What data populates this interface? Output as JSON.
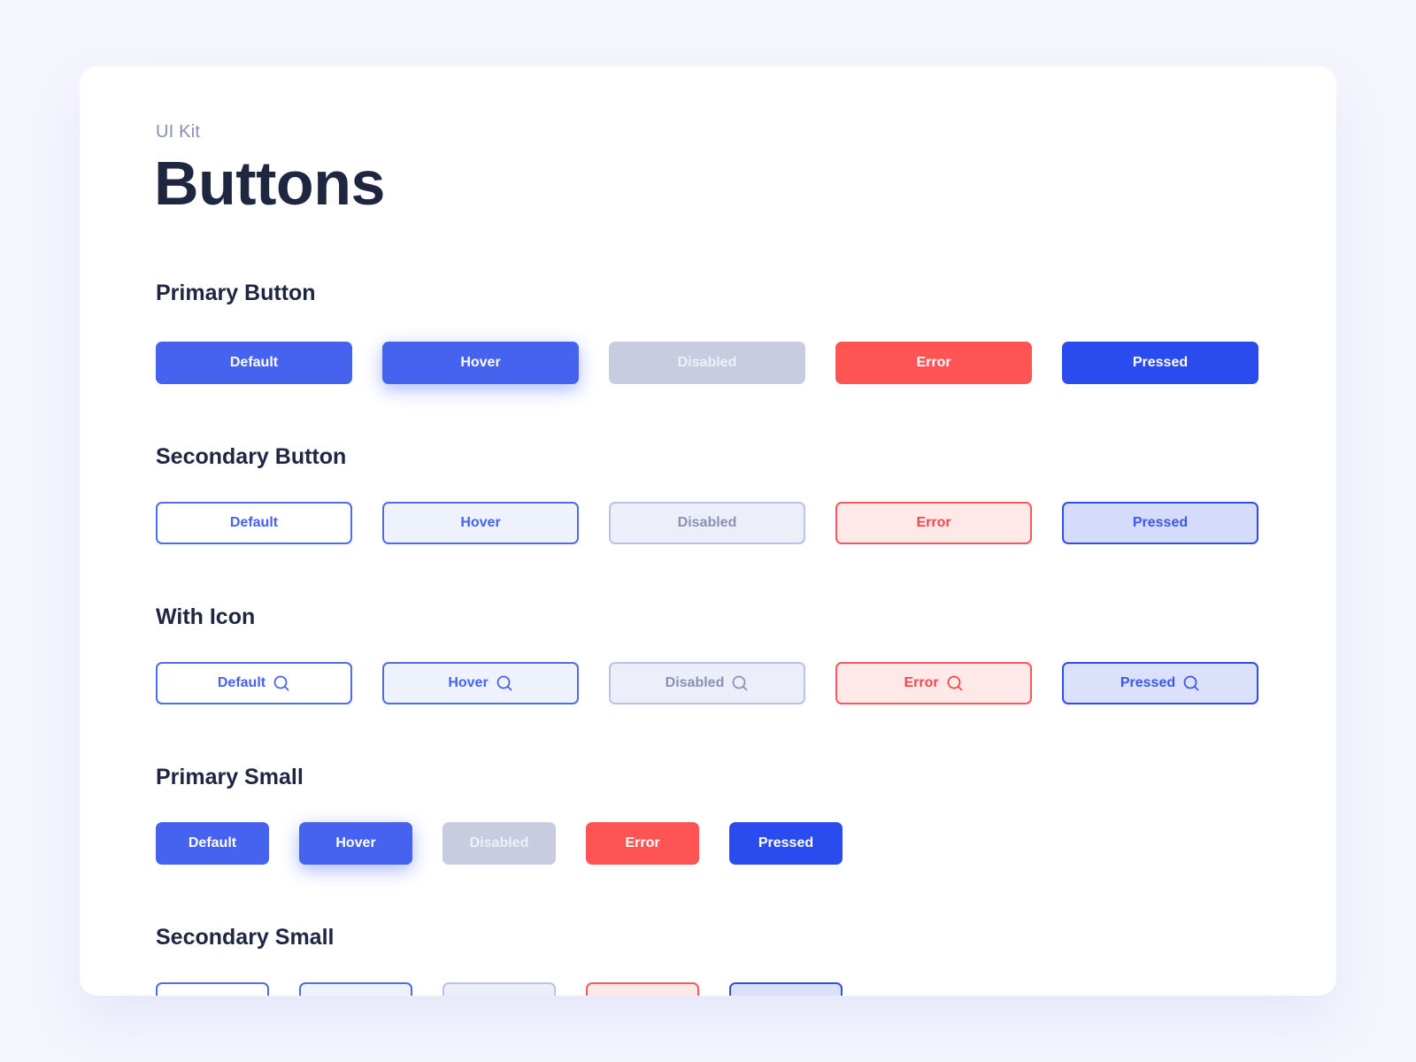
{
  "header": {
    "eyebrow": "UI Kit",
    "title": "Buttons"
  },
  "sections": [
    {
      "title": "Primary Button",
      "buttons": [
        {
          "label": "Default",
          "state": "default"
        },
        {
          "label": "Hover",
          "state": "hover"
        },
        {
          "label": "Disabled",
          "state": "disabled"
        },
        {
          "label": "Error",
          "state": "error"
        },
        {
          "label": "Pressed",
          "state": "pressed"
        }
      ]
    },
    {
      "title": "Secondary Button",
      "buttons": [
        {
          "label": "Default",
          "state": "default"
        },
        {
          "label": "Hover",
          "state": "hover"
        },
        {
          "label": "Disabled",
          "state": "disabled"
        },
        {
          "label": "Error",
          "state": "error"
        },
        {
          "label": "Pressed",
          "state": "pressed"
        }
      ]
    },
    {
      "title": "With Icon",
      "icon": "search-icon",
      "buttons": [
        {
          "label": "Default",
          "state": "default"
        },
        {
          "label": "Hover",
          "state": "hover"
        },
        {
          "label": "Disabled",
          "state": "disabled"
        },
        {
          "label": "Error",
          "state": "error"
        },
        {
          "label": "Pressed",
          "state": "pressed"
        }
      ]
    },
    {
      "title": "Primary Small",
      "buttons": [
        {
          "label": "Default",
          "state": "default"
        },
        {
          "label": "Hover",
          "state": "hover"
        },
        {
          "label": "Disabled",
          "state": "disabled"
        },
        {
          "label": "Error",
          "state": "error"
        },
        {
          "label": "Pressed",
          "state": "pressed"
        }
      ]
    },
    {
      "title": "Secondary Small",
      "buttons": [
        {
          "label": "",
          "state": "default"
        },
        {
          "label": "",
          "state": "hover"
        },
        {
          "label": "",
          "state": "disabled"
        },
        {
          "label": "",
          "state": "error"
        },
        {
          "label": "",
          "state": "pressed"
        }
      ]
    }
  ],
  "colors": {
    "primary": "#4563ee",
    "primary_pressed": "#2a4bee",
    "disabled": "#c8cce1",
    "error": "#ff5454",
    "heading": "#1f2640",
    "muted": "#8a8fa8",
    "page_background": "#f4f5fd"
  }
}
